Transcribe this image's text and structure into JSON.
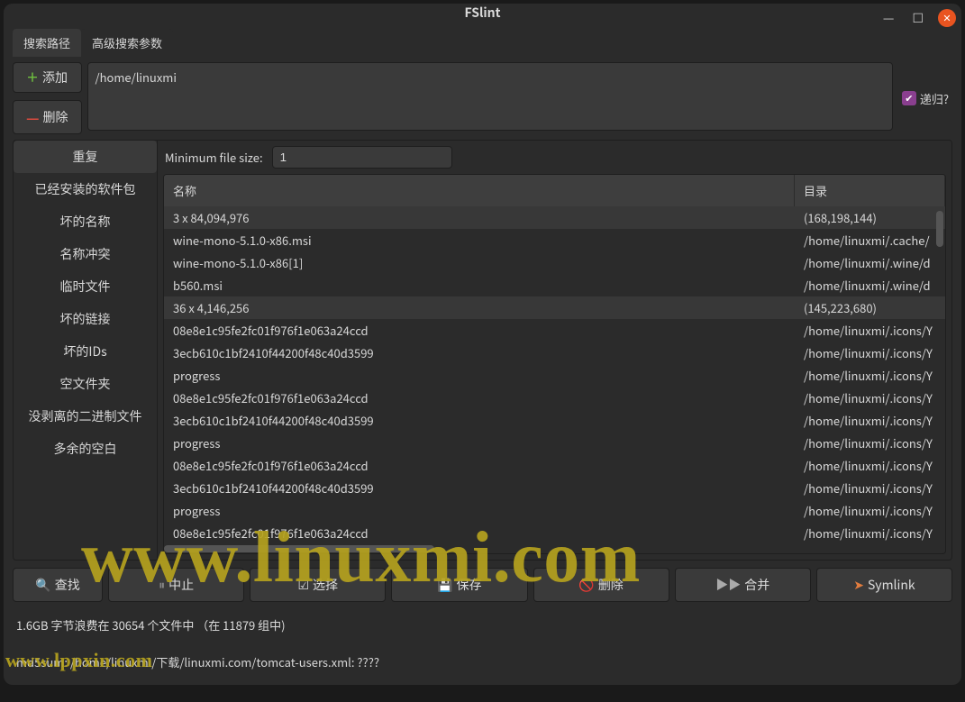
{
  "window": {
    "title": "FSlint"
  },
  "tabs": {
    "search_path": "搜索路径",
    "advanced": "高级搜索参数"
  },
  "path_buttons": {
    "add": "添加",
    "remove": "删除"
  },
  "path_box": {
    "path": "/home/linuxmi"
  },
  "recurse": {
    "label": "递归?"
  },
  "side_nav": [
    "重复",
    "已经安装的软件包",
    "坏的名称",
    "名称冲突",
    "临时文件",
    "坏的链接",
    "坏的IDs",
    "空文件夹",
    "没剥离的二进制文件",
    "多余的空白"
  ],
  "filter": {
    "label": "Minimum file size:",
    "value": "1"
  },
  "columns": {
    "name": "名称",
    "dir": "目录"
  },
  "rows": [
    {
      "group": true,
      "name": "3 x 84,094,976",
      "dir": "(168,198,144)"
    },
    {
      "name": "wine-mono-5.1.0-x86.msi",
      "dir": "/home/linuxmi/.cache/"
    },
    {
      "name": "wine-mono-5.1.0-x86[1]",
      "dir": "/home/linuxmi/.wine/d"
    },
    {
      "name": "b560.msi",
      "dir": "/home/linuxmi/.wine/d"
    },
    {
      "group": true,
      "name": "36 x 4,146,256",
      "dir": "(145,223,680)"
    },
    {
      "name": "08e8e1c95fe2fc01f976f1e063a24ccd",
      "dir": "/home/linuxmi/.icons/Y"
    },
    {
      "name": "3ecb610c1bf2410f44200f48c40d3599",
      "dir": "/home/linuxmi/.icons/Y"
    },
    {
      "name": "progress",
      "dir": "/home/linuxmi/.icons/Y"
    },
    {
      "name": "08e8e1c95fe2fc01f976f1e063a24ccd",
      "dir": "/home/linuxmi/.icons/Y"
    },
    {
      "name": "3ecb610c1bf2410f44200f48c40d3599",
      "dir": "/home/linuxmi/.icons/Y"
    },
    {
      "name": "progress",
      "dir": "/home/linuxmi/.icons/Y"
    },
    {
      "name": "08e8e1c95fe2fc01f976f1e063a24ccd",
      "dir": "/home/linuxmi/.icons/Y"
    },
    {
      "name": "3ecb610c1bf2410f44200f48c40d3599",
      "dir": "/home/linuxmi/.icons/Y"
    },
    {
      "name": "progress",
      "dir": "/home/linuxmi/.icons/Y"
    },
    {
      "name": "08e8e1c95fe2fc01f976f1e063a24ccd",
      "dir": "/home/linuxmi/.icons/Y"
    }
  ],
  "actions": {
    "find": "查找",
    "pause": "中止",
    "select": "选择",
    "save": "保存",
    "delete": "删除",
    "merge": "合并",
    "symlink": "Symlink"
  },
  "status": "1.6GB 字节浪费在 30654 个文件中 （在 11879 组中)",
  "md5": "md5sum: /home/linuxmi/下载/linuxmi.com/tomcat-users.xml: ????",
  "watermark1": "www.linuxmi.com",
  "watermark2": "www.lppxin.com"
}
